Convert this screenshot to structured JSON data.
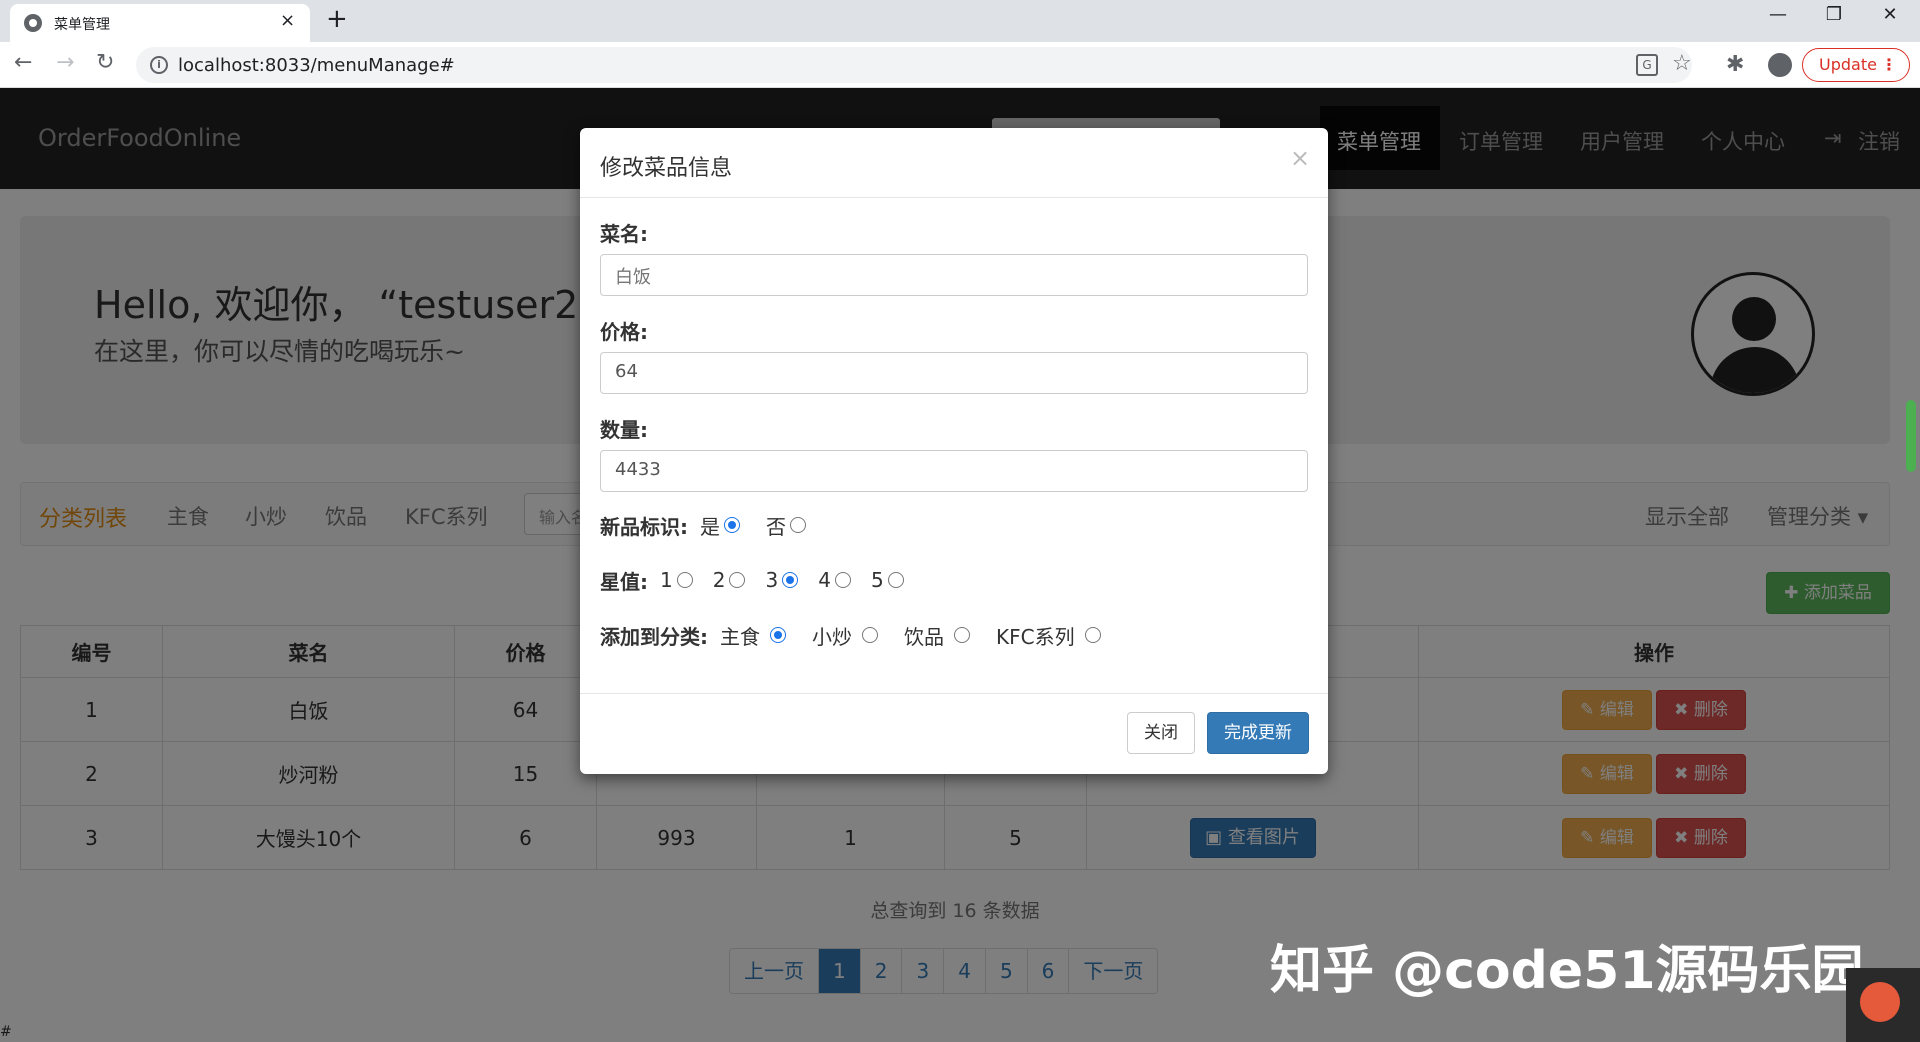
{
  "browser": {
    "tab_title": "菜单管理",
    "tab_close": "×",
    "new_tab": "+",
    "url": "localhost:8033/menuManage#",
    "update_label": "Update",
    "menu_dots": "⋮",
    "translate_glyph": "G"
  },
  "navbar": {
    "brand": "OrderFoodOnline",
    "links": [
      "菜单管理",
      "订单管理",
      "用户管理",
      "个人中心"
    ],
    "logout": "注销",
    "logout_icon_glyph": "⇥"
  },
  "jumbotron": {
    "title": "Hello, 欢迎你，  “testuser2”",
    "subtitle": "在这里，你可以尽情的吃喝玩乐~"
  },
  "categories": {
    "title": "分类列表",
    "items": [
      "主食",
      "小炒",
      "饮品",
      "KFC系列"
    ],
    "search_placeholder": "输入名",
    "show_all": "显示全部",
    "manage": "管理分类 ▾"
  },
  "add_dish_label": "✚ 添加菜品",
  "table": {
    "headers": [
      "编号",
      "菜名",
      "价格",
      "",
      "",
      "",
      "",
      "操作"
    ],
    "rows": [
      {
        "id": "1",
        "name": "白饭",
        "price": "64",
        "c4": "",
        "c5": "",
        "c6": "",
        "img": "",
        "edit": "✎ 编辑",
        "del": "✖ 删除"
      },
      {
        "id": "2",
        "name": "炒河粉",
        "price": "15",
        "c4": "",
        "c5": "",
        "c6": "",
        "img": "",
        "edit": "✎ 编辑",
        "del": "✖ 删除"
      },
      {
        "id": "3",
        "name": "大馒头10个",
        "price": "6",
        "c4": "993",
        "c5": "1",
        "c6": "5",
        "img": "▣ 查看图片",
        "edit": "✎ 编辑",
        "del": "✖ 删除"
      }
    ]
  },
  "total_text": "总查询到 16 条数据",
  "pager": [
    "上一页",
    "1",
    "2",
    "3",
    "4",
    "5",
    "6",
    "下一页"
  ],
  "watermark": "知乎 @code51源码乐园",
  "hash_text": "#",
  "modal": {
    "title": "修改菜品信息",
    "close_glyph": "×",
    "name_label": "菜名:",
    "name_value": "白饭",
    "price_label": "价格:",
    "price_value": "64",
    "qty_label": "数量:",
    "qty_value": "4433",
    "new_label": "新品标识:",
    "new_options": [
      "是",
      "否"
    ],
    "star_label": "星值:",
    "star_options": [
      "1",
      "2",
      "3",
      "4",
      "5"
    ],
    "cat_label": "添加到分类:",
    "cat_options": [
      "主食",
      "小炒",
      "饮品",
      "KFC系列"
    ],
    "btn_close": "关闭",
    "btn_update": "完成更新"
  },
  "colors": {
    "navbar_bg": "#222222",
    "primary": "#337ab7",
    "success": "#5cb85c",
    "warning": "#f0ad4e",
    "danger": "#d9534f",
    "category_title": "#e38d13"
  }
}
